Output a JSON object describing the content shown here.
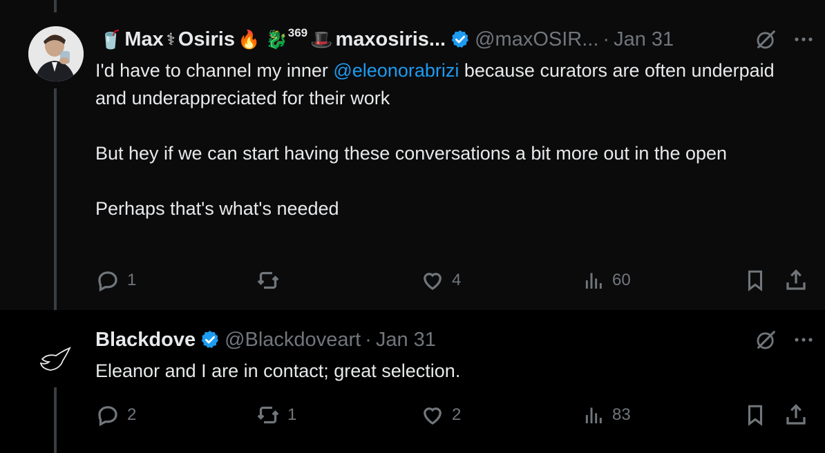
{
  "posts": [
    {
      "display_name_parts": [
        "Max",
        "Osiris",
        "maxosiris..."
      ],
      "name_emojis": [
        "🥤",
        "⚕",
        "🔥",
        "🐉",
        "369",
        "🎩"
      ],
      "handle": "@maxOSIR...",
      "dot": "·",
      "time": "Jan 31",
      "body": {
        "line1_before": "I'd have to channel my inner ",
        "mention": "@eleonorabrizi",
        "line1_after": " because curators are often underpaid and underappreciated for their work",
        "para2": "But hey if we can start having these conversations a bit more out in the open",
        "para3": "Perhaps that's what's needed"
      },
      "stats": {
        "replies": "1",
        "reposts": "",
        "likes": "4",
        "views": "60"
      },
      "icons": {
        "avatar": "man-drinking-avatar",
        "verified": "blue-verified-badge",
        "grok": "grok-icon",
        "more": "more-icon"
      }
    },
    {
      "display_name": "Blackdove",
      "handle": "@Blackdoveart",
      "dot": "·",
      "time": "Jan 31",
      "body": "Eleanor and I are in contact; great selection.",
      "stats": {
        "replies": "2",
        "reposts": "1",
        "likes": "2",
        "views": "83"
      },
      "icons": {
        "avatar": "dove-logo-avatar",
        "verified": "blue-verified-badge",
        "grok": "grok-icon",
        "more": "more-icon"
      }
    }
  ],
  "colors": {
    "background": "#000000",
    "text": "#e7e9ea",
    "muted": "#71767b",
    "accent": "#1d9bf0"
  }
}
